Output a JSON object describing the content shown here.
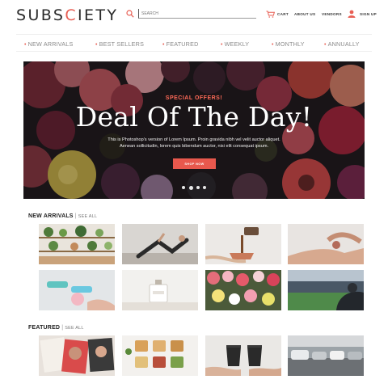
{
  "header": {
    "logo_part1": "SUBS",
    "logo_part2": "C",
    "logo_part3": "IETY",
    "search_placeholder": "SEARCH",
    "links": {
      "cart": "CART",
      "about": "ABOUT US",
      "vendors": "VENDORS",
      "signup": "SIGN UP"
    },
    "icons": {
      "search": "search-icon",
      "cart": "cart-icon",
      "user": "user-icon"
    },
    "accent_color": "#e85f54"
  },
  "categories": [
    "NEW ARRIVALS",
    "BEST SELLERS",
    "FEATURED",
    "WEEKLY",
    "MONTHLY",
    "ANNUALLY"
  ],
  "hero": {
    "kicker": "SPECIAL OFFERS!",
    "title": "Deal Of The Day!",
    "description": "This is Photoshop's version of Lorem Ipsum. Proin gravida nibh vel velit auctor aliquet. Aenean sollicitudin, lorem quis bibendum auctor, nisi elit consequat ipsum.",
    "button": "SHOP NOW",
    "dots_count": 4,
    "active_dot": 1
  },
  "sections": {
    "new_arrivals": {
      "title": "NEW ARRIVALS",
      "see_all": "SEE ALL"
    },
    "featured": {
      "title": "FEATURED",
      "see_all": "SEE ALL"
    }
  },
  "products": {
    "new_arrivals": [
      {
        "subject": "plant shelf"
      },
      {
        "subject": "yoga pose"
      },
      {
        "subject": "pouring coffee"
      },
      {
        "subject": "holding hands"
      },
      {
        "subject": "dumbbells"
      },
      {
        "subject": "perfume bottle"
      },
      {
        "subject": "flower market"
      },
      {
        "subject": "stadium"
      }
    ],
    "featured": [
      {
        "subject": "magazines"
      },
      {
        "subject": "toast plates"
      },
      {
        "subject": "coffee cups"
      },
      {
        "subject": "parked cars"
      }
    ]
  }
}
